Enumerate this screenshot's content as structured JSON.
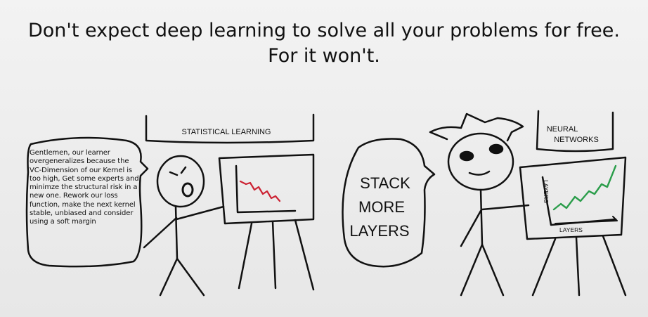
{
  "title_line1": "Don't expect deep learning to solve all your problems for free.",
  "title_line2": "For it won't.",
  "left_panel": {
    "sign": "STATISTICAL LEARNING",
    "speech_bubble": "Gentlemen, our learner overgeneralizes because the VC-Dimension of our Kernel is too high, Get some experts and minimze the structural risk in a new one. Rework our loss function, make the next kernel stable, unbiased and consider using a soft margin"
  },
  "right_panel": {
    "bubble_line1": "STACK",
    "bubble_line2": "MORE",
    "bubble_line3": "LAYERS",
    "sign_line1": "NEURAL",
    "sign_line2": "NETWORKS",
    "chart_y_label": "LAYERS",
    "chart_x_label": "LAYERS"
  },
  "colors": {
    "ink": "#111111",
    "red_line": "#cc2233",
    "green_line": "#2a9d4a"
  }
}
